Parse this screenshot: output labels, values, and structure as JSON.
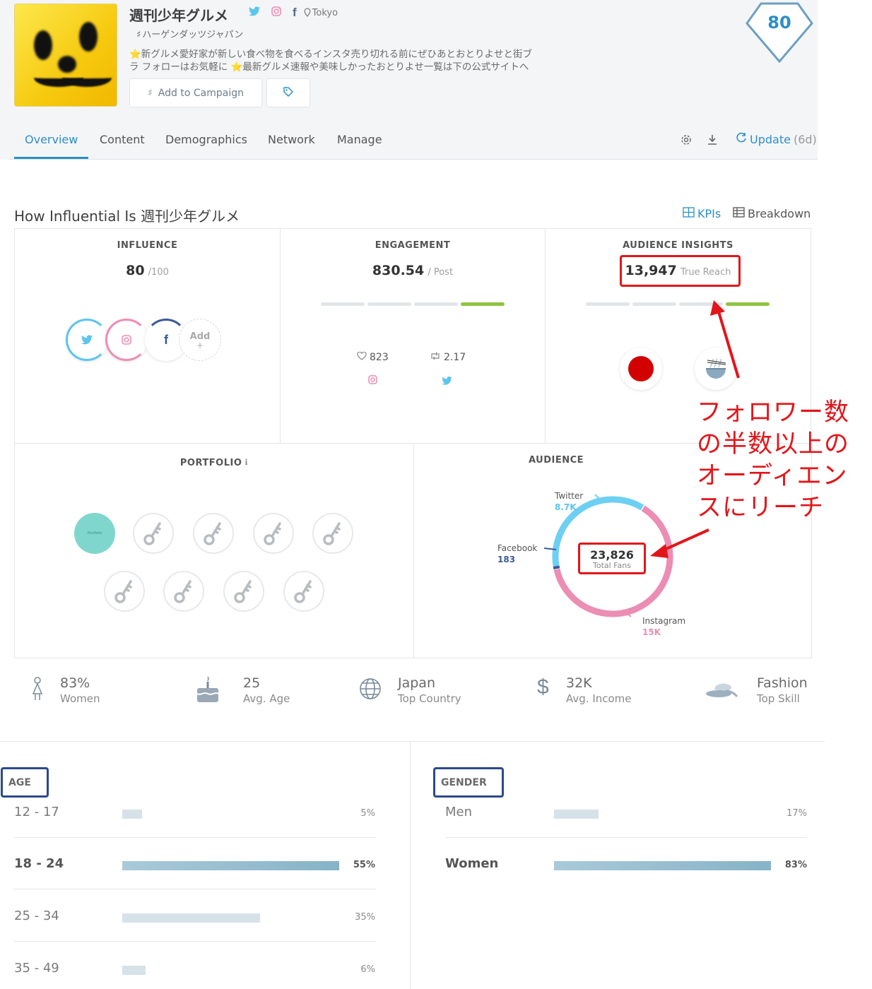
{
  "profile": {
    "name": "週刊少年グルメ",
    "location": "Tokyo",
    "hashtag": "ハーゲンダッツジャパン",
    "bio_line1": "⭐新グルメ愛好家が新しい食べ物を食べるインスタ売り切れる前にぜひあとおとりよせと街ブ",
    "bio_line2": "ラ フォローはお気軽に ⭐最新グルメ速報や美味しかったおとりよせ一覧は下の公式サイトへ",
    "score": "80",
    "add_to_campaign": "Add to Campaign"
  },
  "nav": {
    "tabs": [
      "Overview",
      "Content",
      "Demographics",
      "Network",
      "Manage"
    ],
    "update_label": "Update",
    "update_age": "(6d)"
  },
  "section": {
    "title": "How Influential Is 週刊少年グルメ",
    "kpis": "KPIs",
    "breakdown": "Breakdown"
  },
  "influence": {
    "title": "INFLUENCE",
    "value": "80",
    "max": "/100",
    "add_label": "Add"
  },
  "engagement": {
    "title": "ENGAGEMENT",
    "value": "830.54",
    "unit": "/ Post",
    "likes": "823",
    "retweets": "2.17",
    "level_segments": 4,
    "level_active": 4
  },
  "audience_insights": {
    "title": "AUDIENCE INSIGHTS",
    "value": "13,947",
    "unit": "True Reach",
    "level_segments": 4,
    "level_active": 4
  },
  "portfolio": {
    "title": "PORTFOLIO",
    "first_item": "Portfolio"
  },
  "audience": {
    "title": "AUDIENCE",
    "total": "23,826",
    "total_label": "Total Fans",
    "twitter_label": "Twitter",
    "twitter_value": "8.7K",
    "facebook_label": "Facebook",
    "facebook_value": "183",
    "instagram_label": "Instagram",
    "instagram_value": "15K"
  },
  "stats": [
    {
      "value": "83%",
      "label": "Women"
    },
    {
      "value": "25",
      "label": "Avg. Age"
    },
    {
      "value": "Japan",
      "label": "Top Country"
    },
    {
      "value": "32K",
      "label": "Avg. Income"
    },
    {
      "value": "Fashion",
      "label": "Top Skill"
    }
  ],
  "age": {
    "title": "AGE",
    "rows": [
      {
        "label": "12 - 17",
        "pct": "5%",
        "value": 5
      },
      {
        "label": "18 - 24",
        "pct": "55%",
        "value": 55
      },
      {
        "label": "25 - 34",
        "pct": "35%",
        "value": 35
      },
      {
        "label": "35 - 49",
        "pct": "6%",
        "value": 6
      }
    ]
  },
  "gender": {
    "title": "GENDER",
    "rows": [
      {
        "label": "Men",
        "pct": "17%",
        "value": 17
      },
      {
        "label": "Women",
        "pct": "83%",
        "value": 83
      }
    ]
  },
  "annotation": {
    "text_lines": [
      "フォロワー数",
      "の半数以上の",
      "オーディエン",
      "スにリーチ"
    ]
  },
  "colors": {
    "accent": "#2b8fc8",
    "annotation": "#e3151a",
    "twitter": "#5bc5ee",
    "instagram": "#ec8db4",
    "facebook": "#3b5998",
    "bar_active": "#8fc440"
  }
}
